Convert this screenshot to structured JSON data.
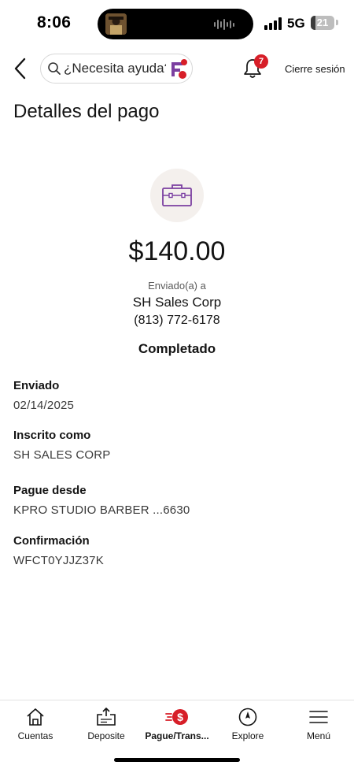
{
  "status_bar": {
    "time": "8:06",
    "network": "5G",
    "battery": "21",
    "battery_level": 0.21
  },
  "header": {
    "search_label": "¿Necesita ayuda?",
    "notification_count": "7",
    "logout_label": "Cierre sesión"
  },
  "page": {
    "title": "Detalles del pago"
  },
  "payment": {
    "amount": "$140.00",
    "sent_to_label": "Enviado(a) a",
    "payee_name": "SH Sales Corp",
    "payee_phone": "(813) 772-6178",
    "status": "Completado"
  },
  "details": [
    {
      "label": "Enviado",
      "value": "02/14/2025"
    },
    {
      "label": "Inscrito como",
      "value": "SH SALES CORP"
    },
    {
      "label": "Pague desde",
      "value": "KPRO STUDIO BARBER ...6630"
    },
    {
      "label": "Confirmación",
      "value": "WFCT0YJJZ37K"
    }
  ],
  "tabbar": {
    "items": [
      {
        "label": "Cuentas",
        "icon": "home-icon"
      },
      {
        "label": "Deposite",
        "icon": "deposit-icon"
      },
      {
        "label": "Pague/Trans...",
        "icon": "pay-transfer-icon",
        "active": true
      },
      {
        "label": "Explore",
        "icon": "compass-icon"
      },
      {
        "label": "Menú",
        "icon": "menu-icon"
      }
    ]
  },
  "colors": {
    "brand_red": "#d71e28",
    "brand_purple": "#7b3fa0",
    "icon_bg": "#f4f0ed"
  }
}
